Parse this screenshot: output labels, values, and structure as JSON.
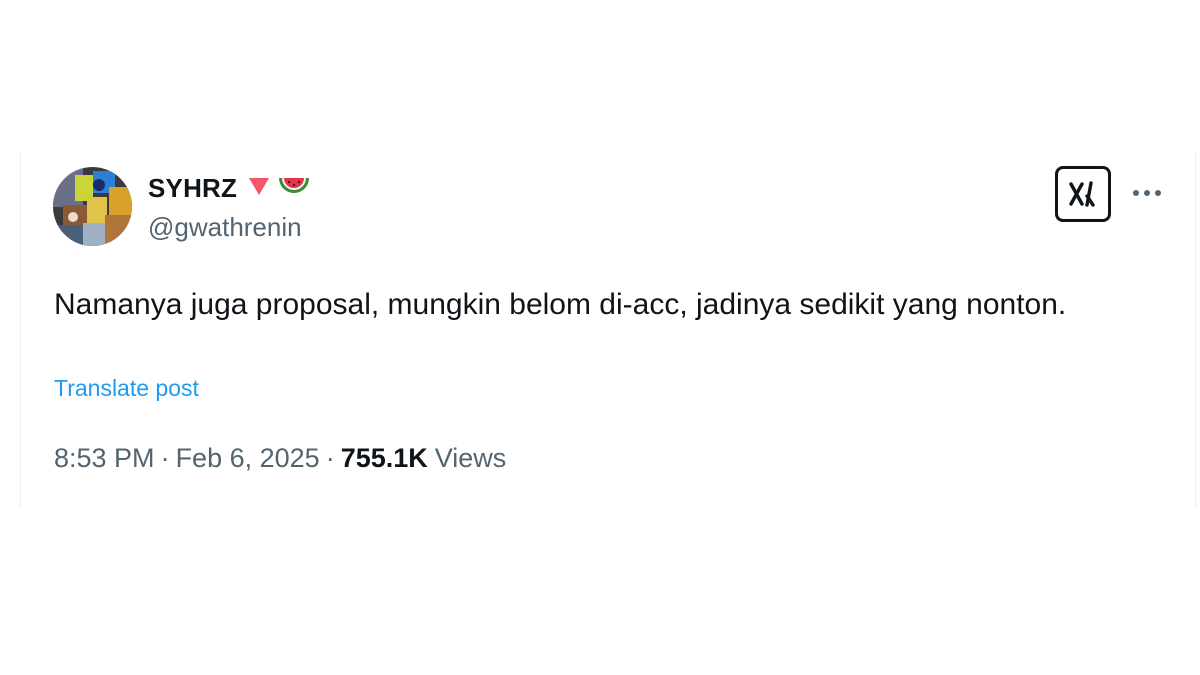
{
  "tweet": {
    "author": {
      "display_name": "SYHRZ",
      "handle": "@gwathrenin",
      "avatar_icon": "avatar-image",
      "name_icons": [
        "red-triangle-down-icon",
        "watermelon-icon"
      ]
    },
    "text": "Namanya juga proposal, mungkin belom di-acc, jadinya sedikit yang nonton.",
    "translate_label": "Translate post",
    "time": "8:53 PM",
    "separator": "·",
    "date": "Feb 6, 2025",
    "views_count": "755.1K",
    "views_label": "Views"
  },
  "actions": {
    "grok_icon": "grok-icon",
    "more_icon": "more-options-icon"
  },
  "colors": {
    "text_primary": "#0f1419",
    "text_secondary": "#536471",
    "link": "#1d9bf0",
    "triangle": "#f4566a",
    "watermelon_red": "#e8314a",
    "watermelon_green": "#3a8a3f"
  }
}
